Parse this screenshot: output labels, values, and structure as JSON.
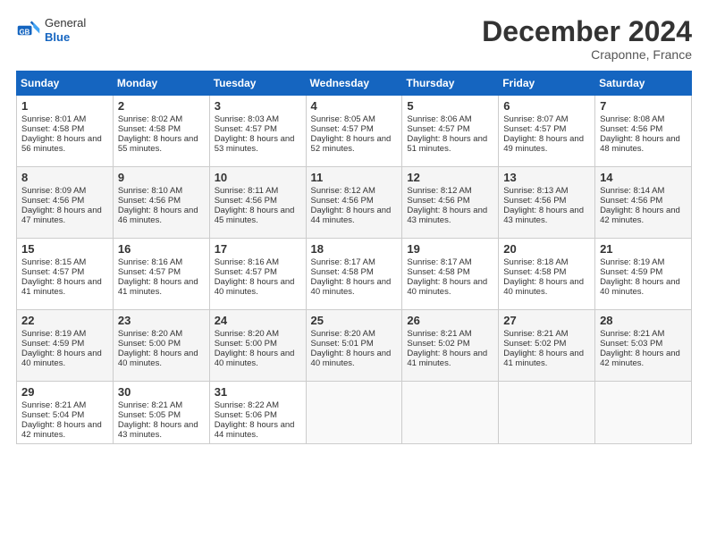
{
  "header": {
    "logo_line1": "General",
    "logo_line2": "Blue",
    "month": "December 2024",
    "location": "Craponne, France"
  },
  "days_header": [
    "Sunday",
    "Monday",
    "Tuesday",
    "Wednesday",
    "Thursday",
    "Friday",
    "Saturday"
  ],
  "weeks": [
    [
      {
        "day": "1",
        "sunrise": "Sunrise: 8:01 AM",
        "sunset": "Sunset: 4:58 PM",
        "daylight": "Daylight: 8 hours and 56 minutes."
      },
      {
        "day": "2",
        "sunrise": "Sunrise: 8:02 AM",
        "sunset": "Sunset: 4:58 PM",
        "daylight": "Daylight: 8 hours and 55 minutes."
      },
      {
        "day": "3",
        "sunrise": "Sunrise: 8:03 AM",
        "sunset": "Sunset: 4:57 PM",
        "daylight": "Daylight: 8 hours and 53 minutes."
      },
      {
        "day": "4",
        "sunrise": "Sunrise: 8:05 AM",
        "sunset": "Sunset: 4:57 PM",
        "daylight": "Daylight: 8 hours and 52 minutes."
      },
      {
        "day": "5",
        "sunrise": "Sunrise: 8:06 AM",
        "sunset": "Sunset: 4:57 PM",
        "daylight": "Daylight: 8 hours and 51 minutes."
      },
      {
        "day": "6",
        "sunrise": "Sunrise: 8:07 AM",
        "sunset": "Sunset: 4:57 PM",
        "daylight": "Daylight: 8 hours and 49 minutes."
      },
      {
        "day": "7",
        "sunrise": "Sunrise: 8:08 AM",
        "sunset": "Sunset: 4:56 PM",
        "daylight": "Daylight: 8 hours and 48 minutes."
      }
    ],
    [
      {
        "day": "8",
        "sunrise": "Sunrise: 8:09 AM",
        "sunset": "Sunset: 4:56 PM",
        "daylight": "Daylight: 8 hours and 47 minutes."
      },
      {
        "day": "9",
        "sunrise": "Sunrise: 8:10 AM",
        "sunset": "Sunset: 4:56 PM",
        "daylight": "Daylight: 8 hours and 46 minutes."
      },
      {
        "day": "10",
        "sunrise": "Sunrise: 8:11 AM",
        "sunset": "Sunset: 4:56 PM",
        "daylight": "Daylight: 8 hours and 45 minutes."
      },
      {
        "day": "11",
        "sunrise": "Sunrise: 8:12 AM",
        "sunset": "Sunset: 4:56 PM",
        "daylight": "Daylight: 8 hours and 44 minutes."
      },
      {
        "day": "12",
        "sunrise": "Sunrise: 8:12 AM",
        "sunset": "Sunset: 4:56 PM",
        "daylight": "Daylight: 8 hours and 43 minutes."
      },
      {
        "day": "13",
        "sunrise": "Sunrise: 8:13 AM",
        "sunset": "Sunset: 4:56 PM",
        "daylight": "Daylight: 8 hours and 43 minutes."
      },
      {
        "day": "14",
        "sunrise": "Sunrise: 8:14 AM",
        "sunset": "Sunset: 4:56 PM",
        "daylight": "Daylight: 8 hours and 42 minutes."
      }
    ],
    [
      {
        "day": "15",
        "sunrise": "Sunrise: 8:15 AM",
        "sunset": "Sunset: 4:57 PM",
        "daylight": "Daylight: 8 hours and 41 minutes."
      },
      {
        "day": "16",
        "sunrise": "Sunrise: 8:16 AM",
        "sunset": "Sunset: 4:57 PM",
        "daylight": "Daylight: 8 hours and 41 minutes."
      },
      {
        "day": "17",
        "sunrise": "Sunrise: 8:16 AM",
        "sunset": "Sunset: 4:57 PM",
        "daylight": "Daylight: 8 hours and 40 minutes."
      },
      {
        "day": "18",
        "sunrise": "Sunrise: 8:17 AM",
        "sunset": "Sunset: 4:58 PM",
        "daylight": "Daylight: 8 hours and 40 minutes."
      },
      {
        "day": "19",
        "sunrise": "Sunrise: 8:17 AM",
        "sunset": "Sunset: 4:58 PM",
        "daylight": "Daylight: 8 hours and 40 minutes."
      },
      {
        "day": "20",
        "sunrise": "Sunrise: 8:18 AM",
        "sunset": "Sunset: 4:58 PM",
        "daylight": "Daylight: 8 hours and 40 minutes."
      },
      {
        "day": "21",
        "sunrise": "Sunrise: 8:19 AM",
        "sunset": "Sunset: 4:59 PM",
        "daylight": "Daylight: 8 hours and 40 minutes."
      }
    ],
    [
      {
        "day": "22",
        "sunrise": "Sunrise: 8:19 AM",
        "sunset": "Sunset: 4:59 PM",
        "daylight": "Daylight: 8 hours and 40 minutes."
      },
      {
        "day": "23",
        "sunrise": "Sunrise: 8:20 AM",
        "sunset": "Sunset: 5:00 PM",
        "daylight": "Daylight: 8 hours and 40 minutes."
      },
      {
        "day": "24",
        "sunrise": "Sunrise: 8:20 AM",
        "sunset": "Sunset: 5:00 PM",
        "daylight": "Daylight: 8 hours and 40 minutes."
      },
      {
        "day": "25",
        "sunrise": "Sunrise: 8:20 AM",
        "sunset": "Sunset: 5:01 PM",
        "daylight": "Daylight: 8 hours and 40 minutes."
      },
      {
        "day": "26",
        "sunrise": "Sunrise: 8:21 AM",
        "sunset": "Sunset: 5:02 PM",
        "daylight": "Daylight: 8 hours and 41 minutes."
      },
      {
        "day": "27",
        "sunrise": "Sunrise: 8:21 AM",
        "sunset": "Sunset: 5:02 PM",
        "daylight": "Daylight: 8 hours and 41 minutes."
      },
      {
        "day": "28",
        "sunrise": "Sunrise: 8:21 AM",
        "sunset": "Sunset: 5:03 PM",
        "daylight": "Daylight: 8 hours and 42 minutes."
      }
    ],
    [
      {
        "day": "29",
        "sunrise": "Sunrise: 8:21 AM",
        "sunset": "Sunset: 5:04 PM",
        "daylight": "Daylight: 8 hours and 42 minutes."
      },
      {
        "day": "30",
        "sunrise": "Sunrise: 8:21 AM",
        "sunset": "Sunset: 5:05 PM",
        "daylight": "Daylight: 8 hours and 43 minutes."
      },
      {
        "day": "31",
        "sunrise": "Sunrise: 8:22 AM",
        "sunset": "Sunset: 5:06 PM",
        "daylight": "Daylight: 8 hours and 44 minutes."
      },
      null,
      null,
      null,
      null
    ]
  ]
}
